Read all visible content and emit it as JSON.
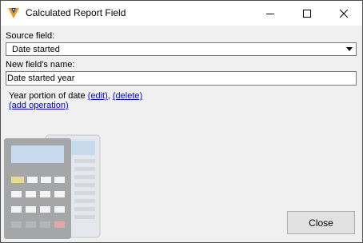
{
  "window": {
    "title": "Calculated Report Field"
  },
  "source": {
    "label": "Source field:",
    "value": "Date started"
  },
  "name_field": {
    "label": "New field's name:",
    "value": "Date started year"
  },
  "operations": {
    "description": "Year portion of date",
    "edit_label": "(edit)",
    "separator": ",",
    "delete_label": "(delete)",
    "add_label": "(add operation)"
  },
  "buttons": {
    "close_label": "Close"
  },
  "colors": {
    "link": "#0000ee",
    "titlebar": "#ffffff",
    "background": "#f0f0f0"
  }
}
